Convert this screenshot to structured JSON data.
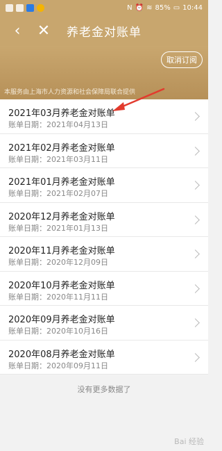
{
  "status": {
    "battery": "85%",
    "time": "10:44",
    "colors": {
      "bar": "#c8a66e"
    }
  },
  "header": {
    "title": "养老金对账单",
    "cancel_label": "取消订阅",
    "note": "本服务由上海市人力资源和社会保障局联合提供"
  },
  "statements": [
    {
      "title": "2021年03月养老金对账单",
      "date_label": "账单日期：2021年04月13日"
    },
    {
      "title": "2021年02月养老金对账单",
      "date_label": "账单日期：2021年03月11日"
    },
    {
      "title": "2021年01月养老金对账单",
      "date_label": "账单日期：2021年02月07日"
    },
    {
      "title": "2020年12月养老金对账单",
      "date_label": "账单日期：2021年01月13日"
    },
    {
      "title": "2020年11月养老金对账单",
      "date_label": "账单日期：2020年12月09日"
    },
    {
      "title": "2020年10月养老金对账单",
      "date_label": "账单日期：2020年11月11日"
    },
    {
      "title": "2020年09月养老金对账单",
      "date_label": "账单日期：2020年10月16日"
    },
    {
      "title": "2020年08月养老金对账单",
      "date_label": "账单日期：2020年09月11日"
    }
  ],
  "footer": {
    "no_more": "没有更多数据了"
  },
  "watermark": "Bai 经验"
}
